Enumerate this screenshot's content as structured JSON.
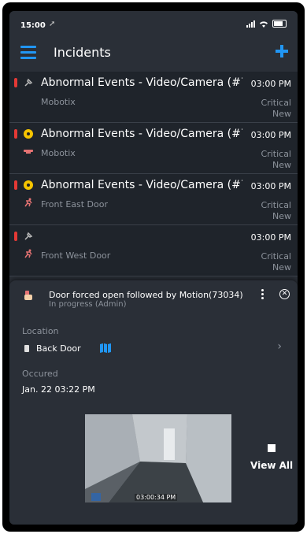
{
  "status_bar": {
    "time": "15:00"
  },
  "header": {
    "title": "Incidents"
  },
  "incidents": [
    {
      "name": "Abnormal Events - Video/Camera (#76...",
      "time": "03:00 PM",
      "source": "Mobotix",
      "severity": "Critical",
      "state": "New",
      "severity_icon": "pin-icon",
      "source_icon": ""
    },
    {
      "name": "Abnormal Events - Video/Camera (#76...",
      "time": "03:00 PM",
      "source": "Mobotix",
      "severity": "Critical",
      "state": "New",
      "severity_icon": "radiation-icon",
      "source_icon": "camera-icon"
    },
    {
      "name": "Abnormal Events - Video/Camera (#76...",
      "time": "03:00 PM",
      "source": "Front East Door",
      "severity": "Critical",
      "state": "New",
      "severity_icon": "radiation-icon",
      "source_icon": "running-person-icon"
    },
    {
      "name": "",
      "time": "03:00 PM",
      "source": "Front West Door",
      "severity": "Critical",
      "state": "New",
      "severity_icon": "pin-icon",
      "source_icon": "running-person-icon"
    }
  ],
  "detail": {
    "title": "Door forced open followed by Motion(73034)",
    "status": "In progress (Admin)",
    "location_label": "Location",
    "location_value": "Back Door",
    "occured_label": "Occured",
    "occured_value": "Jan. 22 03:22 PM",
    "video_timestamp": "03:00:34 PM",
    "view_all_label": "View All"
  },
  "colors": {
    "accent": "#2196f3",
    "critical": "#e53935",
    "warning_icon": "#f5c400",
    "background": "#2a2f37",
    "list_row": "#1f242b"
  }
}
